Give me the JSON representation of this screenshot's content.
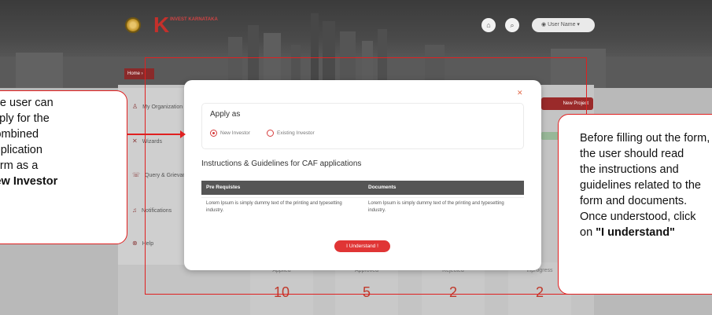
{
  "header": {
    "logo_text": "INVEST KARNATAKA",
    "user_menu": "User Name",
    "icons": [
      "home-icon",
      "search-icon",
      "user-icon"
    ]
  },
  "breadcrumb": {
    "home": "Home"
  },
  "sidebar": {
    "items": [
      {
        "label": "My Organization",
        "icon": "org-icon"
      },
      {
        "label": "Wizards",
        "icon": "wizard-icon"
      },
      {
        "label": "Query & Grievance",
        "icon": "query-icon"
      },
      {
        "label": "Notifications",
        "icon": "bell-icon"
      },
      {
        "label": "Help",
        "icon": "help-icon"
      }
    ]
  },
  "page": {
    "new_project": "New Project"
  },
  "stats": [
    {
      "label": "Applied",
      "value": "10"
    },
    {
      "label": "Approved",
      "value": "5"
    },
    {
      "label": "Rejected",
      "value": "2"
    },
    {
      "label": "Inprogress",
      "value": "2"
    }
  ],
  "modal": {
    "apply_as_title": "Apply as",
    "options": [
      {
        "label": "New Investor",
        "selected": true
      },
      {
        "label": "Existing Investor",
        "selected": false
      }
    ],
    "instructions_title": "Instructions & Guidelines for CAF applications",
    "table": {
      "headers": [
        "Pre Requistes",
        "Documents"
      ],
      "row": [
        "Lorem Ipsum is simply dummy text of the printing and typesetting industry.",
        "Lorem Ipsum is simply dummy text of the printing and typesetting industry."
      ]
    },
    "button": "I Understand !"
  },
  "annotations": {
    "left_lines": [
      "The user can",
      "apply for the",
      "Combined",
      "Application",
      "Form as a"
    ],
    "left_bold": "New Investor",
    "right_lines": [
      "Before filling out the form,",
      "the user should read",
      "the instructions and",
      "guidelines related to the",
      "form and documents.",
      "Once understood, click"
    ],
    "right_prefix": "on ",
    "right_bold": "\"I understand\""
  },
  "colors": {
    "accent": "#e03535",
    "annotation": "#e02020",
    "table_header": "#555555"
  }
}
